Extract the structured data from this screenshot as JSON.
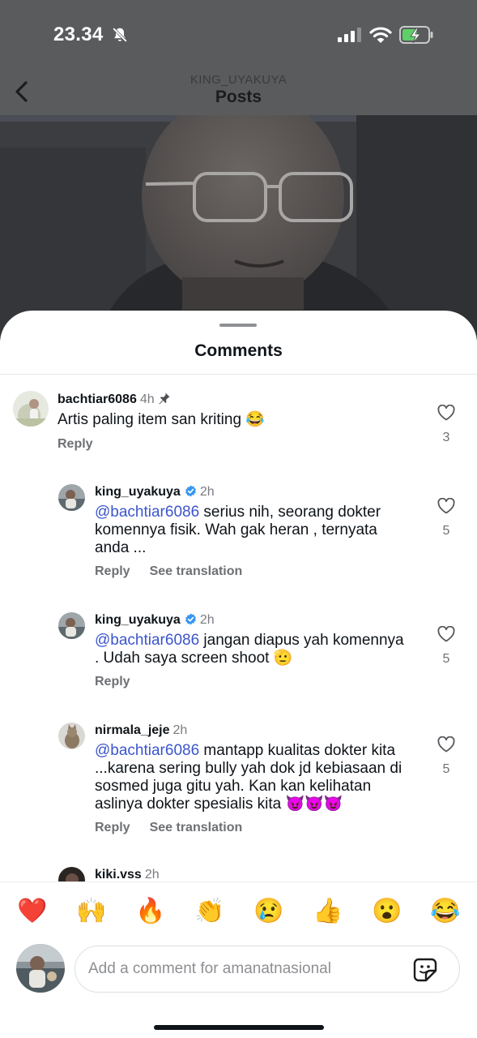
{
  "status_bar": {
    "time": "23.34",
    "icons": [
      "bell-slash-icon",
      "cellular-signal-icon",
      "wifi-icon",
      "battery-charging-icon"
    ]
  },
  "nav": {
    "username": "KING_UYAKUYA",
    "title": "Posts"
  },
  "sheet": {
    "title": "Comments"
  },
  "comments": [
    {
      "username": "bachtiar6086",
      "time": "4h",
      "pinned": true,
      "text": "Artis paling item san kriting 😂",
      "actions": [
        "Reply"
      ],
      "likes": "3"
    },
    {
      "username": "king_uyakuya",
      "verified": true,
      "time": "2h",
      "mention": "@bachtiar6086",
      "text": " serius nih, seorang dokter komennya fisik. Wah gak heran , ternyata anda ...",
      "actions": [
        "Reply",
        "See translation"
      ],
      "likes": "5"
    },
    {
      "username": "king_uyakuya",
      "verified": true,
      "time": "2h",
      "mention": "@bachtiar6086",
      "text": " jangan diapus yah komennya . Udah saya screen shoot 🫡",
      "actions": [
        "Reply"
      ],
      "likes": "5"
    },
    {
      "username": "nirmala_jeje",
      "time": "2h",
      "mention": "@bachtiar6086",
      "text": " mantapp kualitas dokter kita ...karena sering bully yah dok jd kebiasaan di sosmed juga gitu yah. Kan kan kelihatan aslinya dokter spesialis kita 😈😈😈",
      "actions": [
        "Reply",
        "See translation"
      ],
      "likes": "5"
    },
    {
      "username": "kiki.vss",
      "time": "2h"
    }
  ],
  "reactions": [
    "❤️",
    "🙌",
    "🔥",
    "👏",
    "😢",
    "👍",
    "😮",
    "😂"
  ],
  "composer": {
    "placeholder": "Add a comment for amanatnasional"
  },
  "colors": {
    "mention": "#3b55cc",
    "verified": "#3897f0",
    "secondary_text": "#6e7074"
  }
}
